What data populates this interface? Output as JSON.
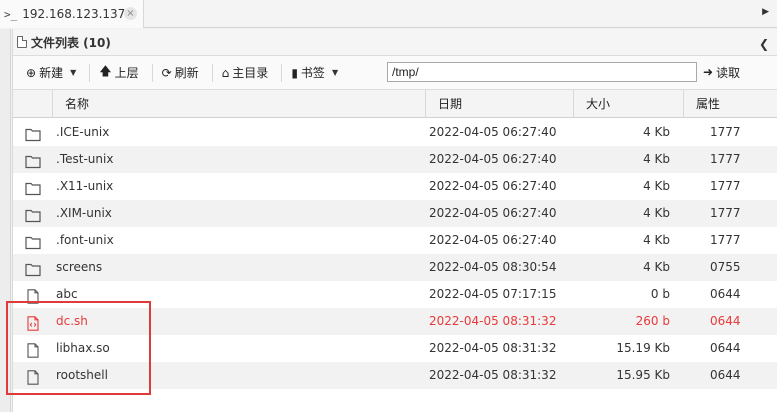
{
  "tab": {
    "prefix": ">_",
    "title": "192.168.123.137",
    "close": "×"
  },
  "panel": {
    "title": "文件列表 (10)"
  },
  "toolbar": {
    "new_label": "新建",
    "up_label": "上层",
    "refresh_label": "刷新",
    "home_label": "主目录",
    "bookmark_label": "书签",
    "path_value": "/tmp/",
    "read_label": "读取"
  },
  "columns": {
    "name": "名称",
    "date": "日期",
    "size": "大小",
    "perm": "属性"
  },
  "files": [
    {
      "name": ".ICE-unix",
      "date": "2022-04-05 06:27:40",
      "size": "4 Kb",
      "perm": "1777",
      "type": "folder"
    },
    {
      "name": ".Test-unix",
      "date": "2022-04-05 06:27:40",
      "size": "4 Kb",
      "perm": "1777",
      "type": "folder"
    },
    {
      "name": ".X11-unix",
      "date": "2022-04-05 06:27:40",
      "size": "4 Kb",
      "perm": "1777",
      "type": "folder"
    },
    {
      "name": ".XIM-unix",
      "date": "2022-04-05 06:27:40",
      "size": "4 Kb",
      "perm": "1777",
      "type": "folder"
    },
    {
      "name": ".font-unix",
      "date": "2022-04-05 06:27:40",
      "size": "4 Kb",
      "perm": "1777",
      "type": "folder"
    },
    {
      "name": "screens",
      "date": "2022-04-05 08:30:54",
      "size": "4 Kb",
      "perm": "0755",
      "type": "folder"
    },
    {
      "name": "abc",
      "date": "2022-04-05 07:17:15",
      "size": "0 b",
      "perm": "0644",
      "type": "file"
    },
    {
      "name": "dc.sh",
      "date": "2022-04-05 08:31:32",
      "size": "260 b",
      "perm": "0644",
      "type": "script"
    },
    {
      "name": "libhax.so",
      "date": "2022-04-05 08:31:32",
      "size": "15.19 Kb",
      "perm": "0644",
      "type": "file"
    },
    {
      "name": "rootshell",
      "date": "2022-04-05 08:31:32",
      "size": "15.95 Kb",
      "perm": "0644",
      "type": "file"
    }
  ],
  "colors": {
    "highlight": "#e83a3a",
    "row_alt": "#f2f2f2"
  }
}
